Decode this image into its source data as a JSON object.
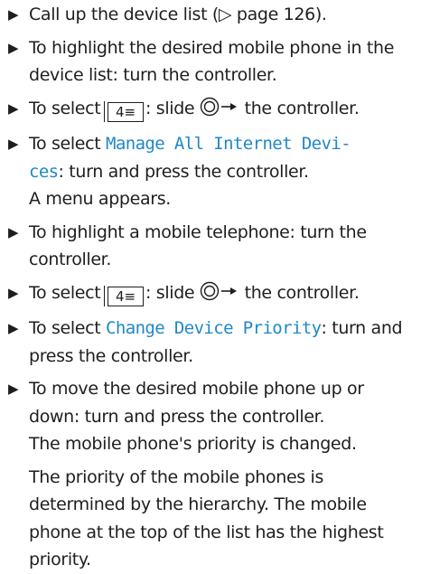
{
  "steps": [
    {
      "parts": [
        "Call up the device list (",
        "▷",
        " page 126)."
      ]
    },
    {
      "text": "To highlight the desired mobile phone in the device list: turn the controller."
    },
    {
      "before": "To select ",
      "after_icon": ": slide ",
      "tail": " the controller.",
      "menu_icon": "menu-icon",
      "controller_icon": "controller-slide-icon"
    },
    {
      "before": "To select ",
      "mono_line1": "Manage All Internet Devi-",
      "mono_line2": "ces",
      "after": ": turn and press the controller.",
      "result": "A menu appears."
    },
    {
      "text": "To highlight a mobile telephone: turn the controller."
    },
    {
      "before": "To select ",
      "after_icon": ": slide ",
      "tail": " the controller.",
      "menu_icon": "menu-icon",
      "controller_icon": "controller-slide-icon"
    },
    {
      "before": "To select ",
      "mono": "Change Device Priority",
      "after": ": turn and press the controller."
    },
    {
      "text": "To move the desired mobile phone up or down: turn and press the controller.",
      "result": "The mobile phone's priority is changed."
    }
  ],
  "note": "The priority of the mobile phones is determined by the hierarchy. The mobile phone at the top of the list has the highest priority.",
  "colors": {
    "text": "#1e1e1e",
    "menu_term": "#1f88c7"
  }
}
